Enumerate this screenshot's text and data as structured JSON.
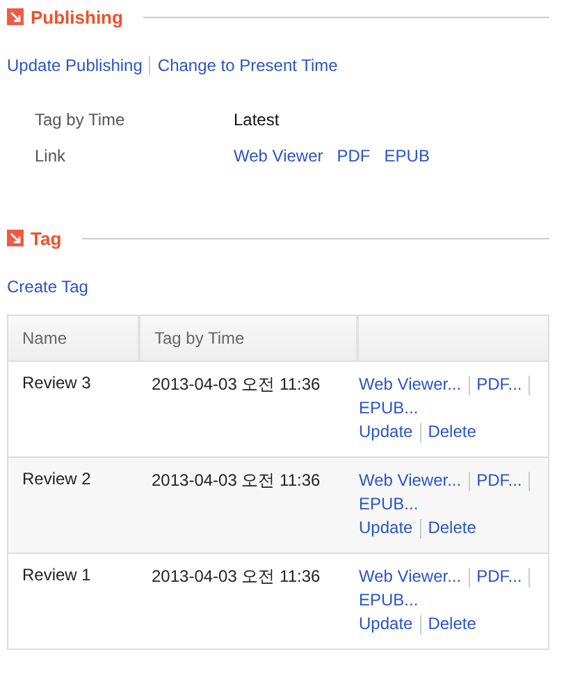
{
  "publishing": {
    "title": "Publishing",
    "actions": [
      "Update Publishing",
      "Change to Present Time"
    ],
    "fields": [
      {
        "kind": "text",
        "label": "Tag by Time",
        "value": "Latest"
      },
      {
        "kind": "links",
        "label": "Link",
        "links": [
          "Web Viewer",
          "PDF",
          "EPUB"
        ]
      }
    ]
  },
  "tag": {
    "title": "Tag",
    "create": "Create Tag",
    "table": {
      "columns": [
        "Name",
        "Tag by Time"
      ],
      "rows": [
        {
          "name": "Review 3",
          "time": "2013-04-03 오전 11:36",
          "links": [
            "Web Viewer...",
            "PDF...",
            "EPUB..."
          ],
          "actions": [
            "Update",
            "Delete"
          ]
        },
        {
          "name": "Review 2",
          "time": "2013-04-03 오전 11:36",
          "links": [
            "Web Viewer...",
            "PDF...",
            "EPUB..."
          ],
          "actions": [
            "Update",
            "Delete"
          ]
        },
        {
          "name": "Review 1",
          "time": "2013-04-03 오전 11:36",
          "links": [
            "Web Viewer...",
            "PDF...",
            "EPUB..."
          ],
          "actions": [
            "Update",
            "Delete"
          ]
        }
      ]
    }
  }
}
